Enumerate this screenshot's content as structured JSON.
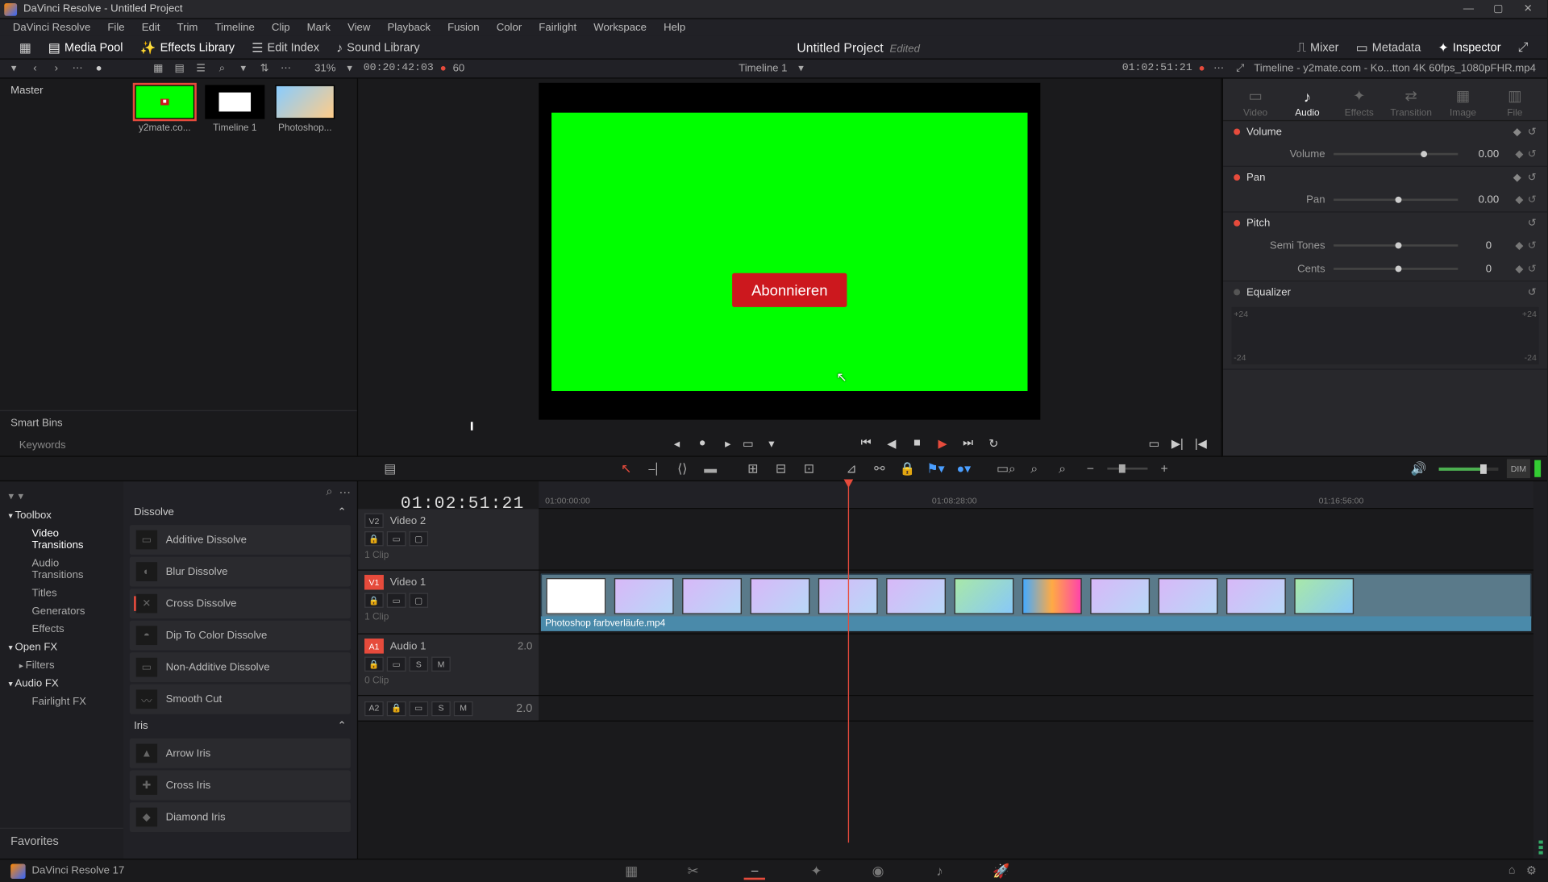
{
  "app": {
    "name": "DaVinci Resolve",
    "project": "Untitled Project"
  },
  "menu": [
    "DaVinci Resolve",
    "File",
    "Edit",
    "Trim",
    "Timeline",
    "Clip",
    "Mark",
    "View",
    "Playback",
    "Fusion",
    "Color",
    "Fairlight",
    "Workspace",
    "Help"
  ],
  "toolbar": {
    "mediapool": "Media Pool",
    "effects": "Effects Library",
    "editindex": "Edit Index",
    "sound": "Sound Library",
    "mixer": "Mixer",
    "metadata": "Metadata",
    "inspector": "Inspector"
  },
  "project_center": {
    "title": "Untitled Project",
    "edited": "Edited"
  },
  "secbar": {
    "zoom": "31%",
    "tc_src": "00:20:42:03",
    "fps": "60",
    "timeline_name": "Timeline 1",
    "tc_right": "01:02:51:21",
    "insp_title": "Timeline - y2mate.com - Ko...tton 4K 60fps_1080pFHR.mp4"
  },
  "mediapool": {
    "master": "Master",
    "smartbins": "Smart Bins",
    "keywords": "Keywords",
    "thumbs": [
      {
        "label": "y2mate.co...",
        "sel": true,
        "bg": "#00ff00"
      },
      {
        "label": "Timeline 1",
        "sel": false,
        "bg": "#000"
      },
      {
        "label": "Photoshop...",
        "sel": false,
        "bg": "linear"
      }
    ]
  },
  "viewer": {
    "subscribe": "Abonnieren"
  },
  "fx": {
    "toolbox": "Toolbox",
    "cats": [
      "Video Transitions",
      "Audio Transitions",
      "Titles",
      "Generators",
      "Effects"
    ],
    "openfx": "Open FX",
    "filters": "Filters",
    "audiofx": "Audio FX",
    "fairlight": "Fairlight FX",
    "favorites": "Favorites",
    "group1": "Dissolve",
    "items1": [
      "Additive Dissolve",
      "Blur Dissolve",
      "Cross Dissolve",
      "Dip To Color Dissolve",
      "Non-Additive Dissolve",
      "Smooth Cut"
    ],
    "group2": "Iris",
    "items2": [
      "Arrow Iris",
      "Cross Iris",
      "Diamond Iris"
    ]
  },
  "timeline": {
    "tc": "01:02:51:21",
    "ticks": [
      "01:00:00:00",
      "01:08:28:00",
      "01:16:56:00"
    ],
    "tracks": {
      "v2": {
        "id": "V2",
        "name": "Video 2",
        "clips": "1 Clip"
      },
      "v1": {
        "id": "V1",
        "name": "Video 1",
        "clips": "1 Clip",
        "clip_label": "Photoshop farbverläufe.mp4"
      },
      "a1": {
        "id": "A1",
        "name": "Audio 1",
        "ch": "2.0",
        "clips": "0 Clip"
      },
      "a2": {
        "id": "A2",
        "ch": "2.0"
      }
    }
  },
  "inspector": {
    "tabs": [
      "Video",
      "Audio",
      "Effects",
      "Transition",
      "Image",
      "File"
    ],
    "volume": {
      "title": "Volume",
      "label": "Volume",
      "value": "0.00"
    },
    "pan": {
      "title": "Pan",
      "label": "Pan",
      "value": "0.00"
    },
    "pitch": {
      "title": "Pitch",
      "semi": "Semi Tones",
      "semi_v": "0",
      "cents": "Cents",
      "cents_v": "0"
    },
    "eq": {
      "title": "Equalizer",
      "l": "+24",
      "l2": "-24",
      "r": "+24",
      "r2": "-24"
    }
  },
  "bottom": {
    "version": "DaVinci Resolve 17"
  }
}
